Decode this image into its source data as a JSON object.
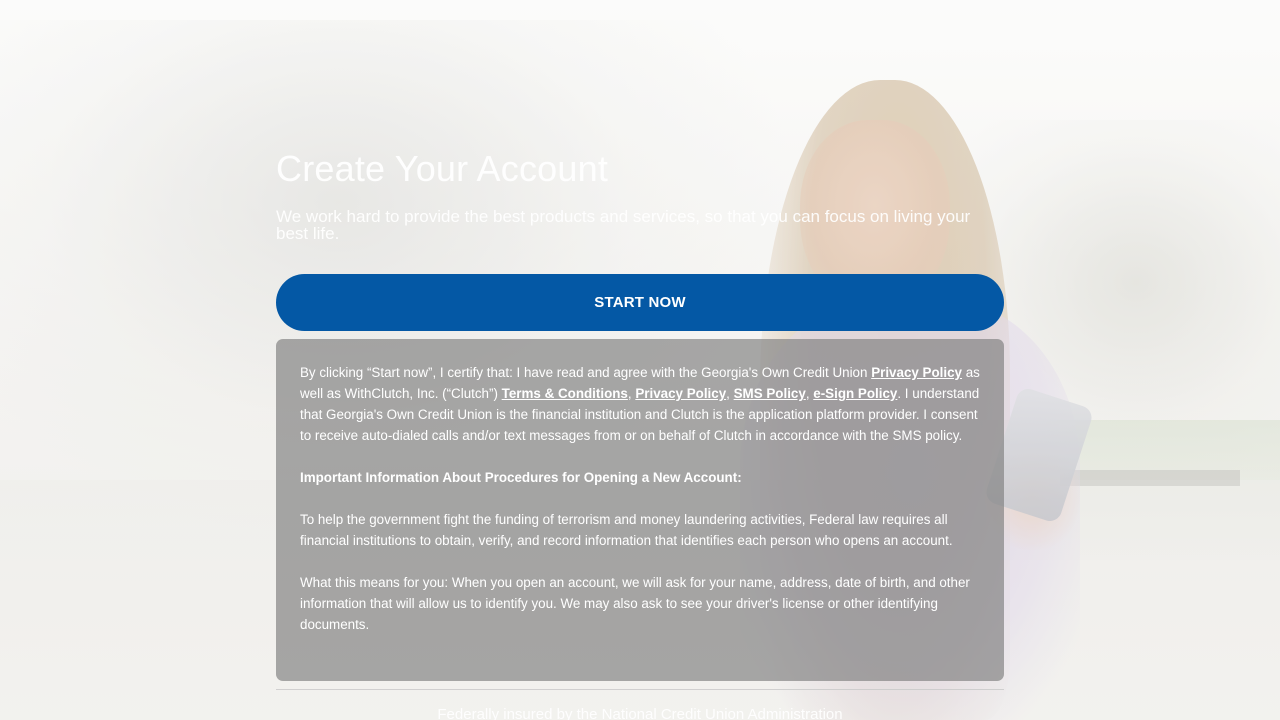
{
  "page": {
    "title": "Create Your Account",
    "subtitle": "We work hard to provide the best products and services, so that you can focus on living your best life."
  },
  "actions": {
    "start_label": "START NOW"
  },
  "disclosure": {
    "p1_part1": "By clicking “Start now”, I certify that: I have read and agree with the Georgia's Own Credit Union ",
    "link_privacy_cu": "Privacy Policy",
    "p1_part2": " as well as WithClutch, Inc. (“Clutch”) ",
    "link_terms": "Terms & Conditions",
    "sep1": ", ",
    "link_privacy_clutch": "Privacy Policy",
    "sep2": ", ",
    "link_sms": "SMS Policy",
    "sep3": ", ",
    "link_esign": "e-Sign Policy",
    "p1_part3": ". I understand that Georgia's Own Credit Union is the financial institution and Clutch is the application platform provider. I consent to receive auto-dialed calls and/or text messages from or on behalf of Clutch in accordance with the SMS policy.",
    "heading": "Important Information About Procedures for Opening a New Account:",
    "p2": "To help the government fight the funding of terrorism and money laundering activities, Federal law requires all financial institutions to obtain, verify, and record information that identifies each person who opens an account.",
    "p3": "What this means for you: When you open an account, we will ask for your name, address, date of birth, and other information that will allow us to identify you. We may also ask to see your driver's license or other identifying documents."
  },
  "footer": {
    "insured_text": "Federally insured by the National Credit Union Administration"
  },
  "colors": {
    "primary_button": "#0458a5",
    "disclosure_panel": "rgba(128,128,128,0.68)"
  }
}
